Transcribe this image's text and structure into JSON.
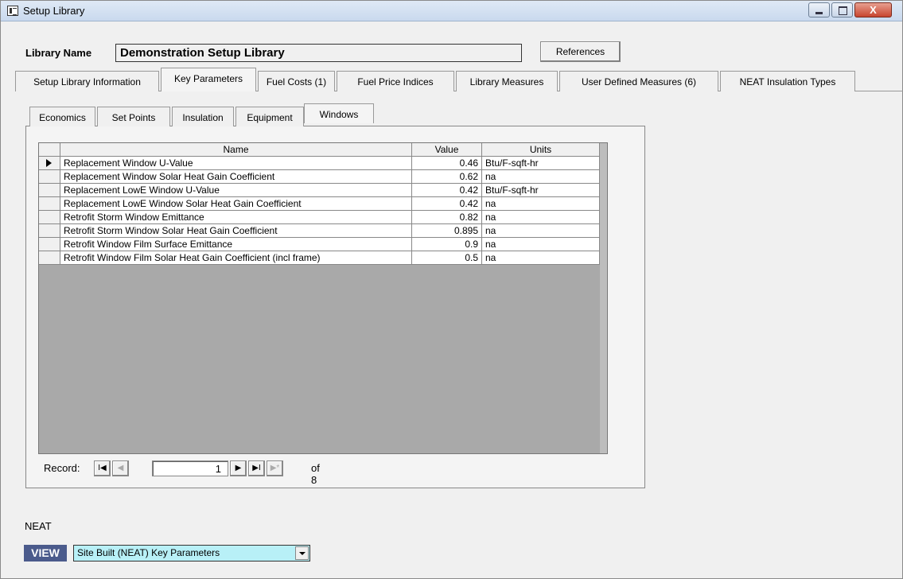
{
  "window": {
    "title": "Setup Library",
    "close_glyph": "X"
  },
  "library": {
    "label": "Library Name",
    "value": "Demonstration Setup Library",
    "references_button": "References"
  },
  "main_tabs": [
    "Setup Library Information",
    "Key Parameters",
    "Fuel Costs (1)",
    "Fuel Price Indices",
    "Library Measures",
    "User Defined Measures (6)",
    "NEAT Insulation Types"
  ],
  "active_main_tab": "Key Parameters",
  "sub_tabs": [
    "Economics",
    "Set Points",
    "Insulation",
    "Equipment",
    "Windows"
  ],
  "active_sub_tab": "Windows",
  "datasheet": {
    "columns": [
      "Name",
      "Value",
      "Units"
    ],
    "rows": [
      {
        "name": "Replacement Window U-Value",
        "value": "0.46",
        "units": "Btu/F-sqft-hr"
      },
      {
        "name": "Replacement Window Solar Heat Gain Coefficient",
        "value": "0.62",
        "units": "na"
      },
      {
        "name": "Replacement LowE Window U-Value",
        "value": "0.42",
        "units": "Btu/F-sqft-hr"
      },
      {
        "name": "Replacement LowE Window Solar Heat Gain Coefficient",
        "value": "0.42",
        "units": "na"
      },
      {
        "name": "Retrofit Storm Window Emittance",
        "value": "0.82",
        "units": "na"
      },
      {
        "name": "Retrofit Storm Window Solar Heat Gain Coefficient",
        "value": "0.895",
        "units": "na"
      },
      {
        "name": "Retrofit Window Film Surface Emittance",
        "value": "0.9",
        "units": "na"
      },
      {
        "name": "Retrofit Window Film Solar Heat Gain Coefficient (incl frame)",
        "value": "0.5",
        "units": "na"
      }
    ]
  },
  "record_nav": {
    "label": "Record:",
    "current": "1",
    "of_text": "of 8",
    "first_glyph": "I◀",
    "prev_glyph": "◀",
    "next_glyph": "▶",
    "last_glyph": "▶I",
    "new_glyph": "▶*"
  },
  "neat": {
    "label": "NEAT",
    "view_badge": "VIEW",
    "view_selected": "Site Built (NEAT) Key Parameters"
  },
  "colors": {
    "view_badge_bg": "#4b5b8c",
    "select_bg": "#b8f0f7",
    "datasheet_bg": "#a9a9a9"
  }
}
